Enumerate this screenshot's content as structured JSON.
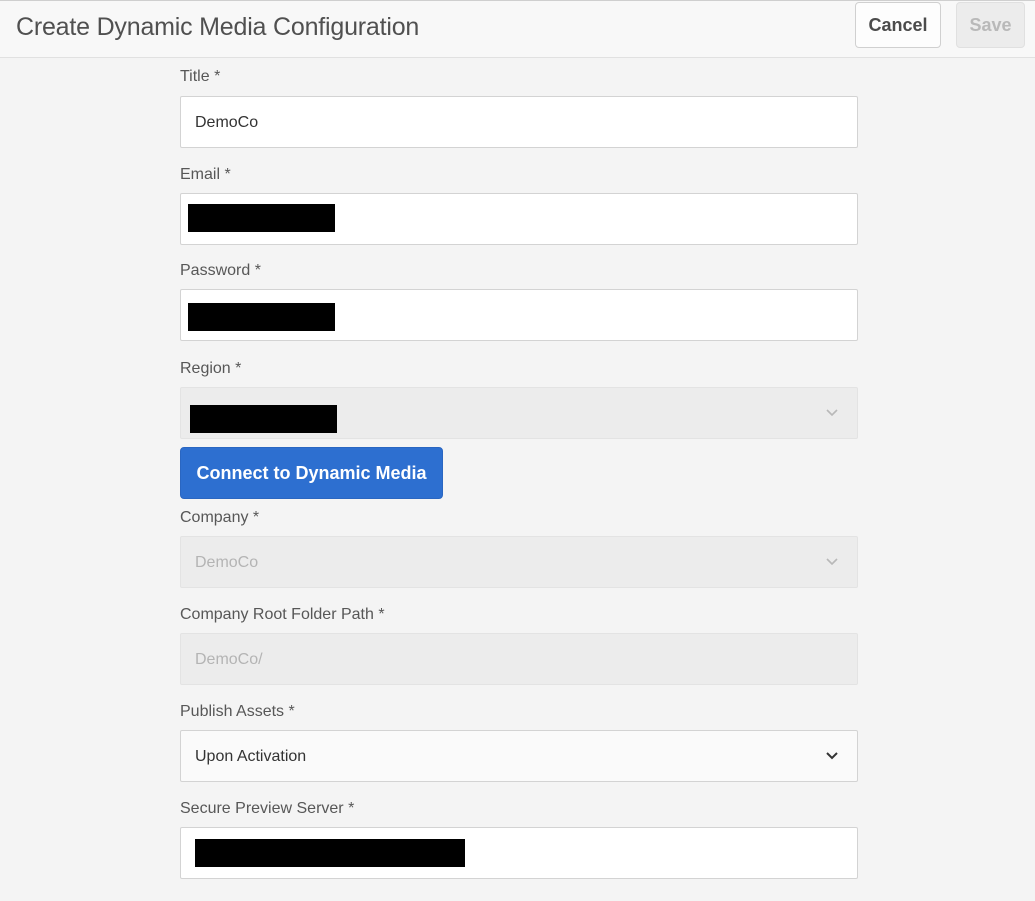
{
  "header": {
    "title": "Create Dynamic Media Configuration",
    "cancel_label": "Cancel",
    "save_label": "Save"
  },
  "form": {
    "title": {
      "label": "Title *",
      "value": "DemoCo"
    },
    "email": {
      "label": "Email *",
      "value": ""
    },
    "password": {
      "label": "Password *",
      "value": ""
    },
    "region": {
      "label": "Region *",
      "value": "",
      "icon": "chevron-down-icon"
    },
    "connect_label": "Connect to Dynamic Media",
    "company": {
      "label": "Company *",
      "value": "DemoCo",
      "icon": "chevron-down-icon"
    },
    "root_folder": {
      "label": "Company Root Folder Path *",
      "value": "DemoCo/"
    },
    "publish_assets": {
      "label": "Publish Assets *",
      "value": "Upon Activation",
      "icon": "chevron-down-icon"
    },
    "preview_server": {
      "label": "Secure Preview Server *",
      "value": ""
    }
  },
  "colors": {
    "accent": "#2d6fd0",
    "background": "#f4f4f4",
    "redaction": "#000000"
  }
}
